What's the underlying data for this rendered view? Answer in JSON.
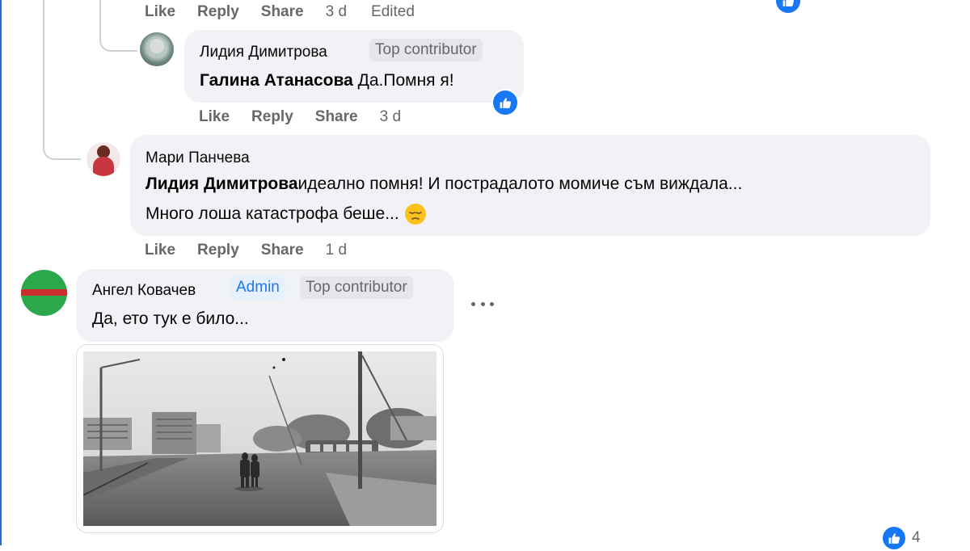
{
  "comments": [
    {
      "actions": {
        "like": "Like",
        "reply": "Reply",
        "share": "Share",
        "time": "3 d",
        "edited": "Edited"
      }
    },
    {
      "author": "Лидия Димитрова",
      "badge": "Top contributor",
      "mention": "Галина Атанасова",
      "text": " Да.Помня я!",
      "reaction_icon": "like-icon",
      "actions": {
        "like": "Like",
        "reply": "Reply",
        "share": "Share",
        "time": "3 d"
      }
    },
    {
      "author": "Мари Панчева",
      "mention": "Лидия Димитрова",
      "text_line1": "идеално помня! И пострадалото момиче съм виждала...",
      "text_line2": "Много лоша катастрофа беше... ",
      "emoji": "pensive-face-emoji",
      "actions": {
        "like": "Like",
        "reply": "Reply",
        "share": "Share",
        "time": "1 d"
      }
    },
    {
      "author": "Ангел Ковачев",
      "badge_admin": "Admin",
      "badge": "Top contributor",
      "text": "Да, ето тук е било...",
      "more_icon": "more-options-icon",
      "attachment": "black-and-white-street-photo",
      "reaction_count": "4"
    }
  ],
  "colors": {
    "accent": "#1877f2",
    "bubble": "#f0f2f5",
    "meta_text": "#65676b",
    "thread_line": "#ced0d4"
  }
}
